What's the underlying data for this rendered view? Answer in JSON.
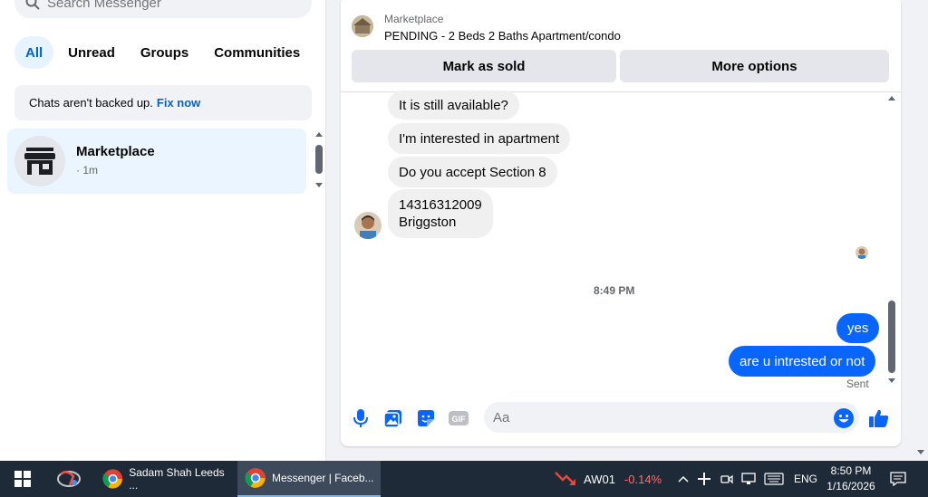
{
  "sidebar": {
    "search_placeholder": "Search Messenger",
    "filters": [
      "All",
      "Unread",
      "Groups",
      "Communities"
    ],
    "backup_text": "Chats aren't backed up.",
    "backup_link": "Fix now",
    "conversations": [
      {
        "name": "Marketplace",
        "time": "· 1m"
      }
    ]
  },
  "listing": {
    "label": "Marketplace",
    "title": "PENDING - 2 Beds 2 Baths Apartment/condo",
    "mark_sold": "Mark as sold",
    "more_options": "More options"
  },
  "messages": {
    "incoming": [
      "It is still available?",
      "I'm interested in apartment",
      "Do you accept  Section 8",
      "14316312009\nBriggston"
    ],
    "timestamp": "8:49 PM",
    "outgoing": [
      "yes",
      "are u intrested or not"
    ],
    "status": "Sent"
  },
  "composer": {
    "placeholder": "Aa"
  },
  "taskbar": {
    "tasks": [
      "Sadam Shah Leeds ...",
      "Messenger | Faceb..."
    ],
    "stock_name": "AW01",
    "stock_change": "-0.14%",
    "language": "ENG",
    "time": "8:50 PM",
    "date": "1/16/2026"
  },
  "colors": {
    "accent": "#0866ff",
    "link": "#0064d1",
    "bubble_in": "#f0f0f0",
    "taskbar": "#1f2a38"
  }
}
